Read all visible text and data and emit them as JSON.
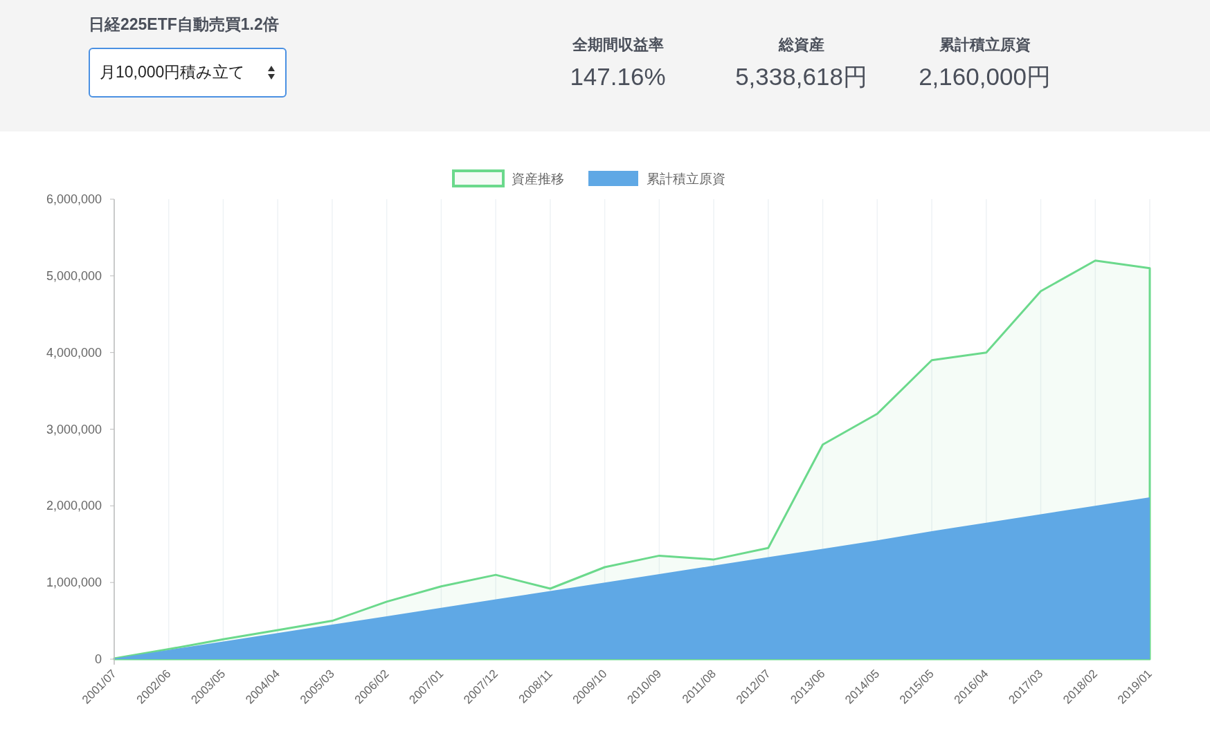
{
  "header": {
    "title": "日経225ETF自動売買1.2倍",
    "plan_select": {
      "value": "月10,000円積み立て"
    },
    "stats": [
      {
        "label": "全期間収益率",
        "value": "147.16%"
      },
      {
        "label": "総資産",
        "value": "5,338,618円"
      },
      {
        "label": "累計積立原資",
        "value": "2,160,000円"
      }
    ]
  },
  "chart": {
    "chart_data": {
      "type": "area",
      "categories": [
        "2001/07",
        "2002/06",
        "2003/05",
        "2004/04",
        "2005/03",
        "2006/02",
        "2007/01",
        "2007/12",
        "2008/11",
        "2009/10",
        "2010/09",
        "2011/08",
        "2012/07",
        "2013/06",
        "2014/05",
        "2015/05",
        "2016/04",
        "2017/03",
        "2018/02",
        "2019/01"
      ],
      "series": [
        {
          "name": "資産推移",
          "color": "#6bd98c",
          "values": [
            10000,
            130000,
            260000,
            380000,
            500000,
            750000,
            950000,
            1100000,
            920000,
            1200000,
            1350000,
            1300000,
            1450000,
            2800000,
            3200000,
            3900000,
            4000000,
            4800000,
            5200000,
            5100000
          ]
        },
        {
          "name": "累計積立原資",
          "color": "#5fa8e5",
          "values": [
            10000,
            120000,
            230000,
            340000,
            450000,
            560000,
            670000,
            780000,
            890000,
            1000000,
            1110000,
            1220000,
            1330000,
            1440000,
            1550000,
            1670000,
            1780000,
            1890000,
            2000000,
            2110000
          ]
        }
      ],
      "yticks": [
        {
          "value": 0,
          "label": "0"
        },
        {
          "value": 1000000,
          "label": "1,000,000"
        },
        {
          "value": 2000000,
          "label": "2,000,000"
        },
        {
          "value": 3000000,
          "label": "3,000,000"
        },
        {
          "value": 4000000,
          "label": "4,000,000"
        },
        {
          "value": 5000000,
          "label": "5,000,000"
        },
        {
          "value": 6000000,
          "label": "6,000,000"
        }
      ],
      "ylim": [
        0,
        6000000
      ],
      "legend": true
    }
  }
}
